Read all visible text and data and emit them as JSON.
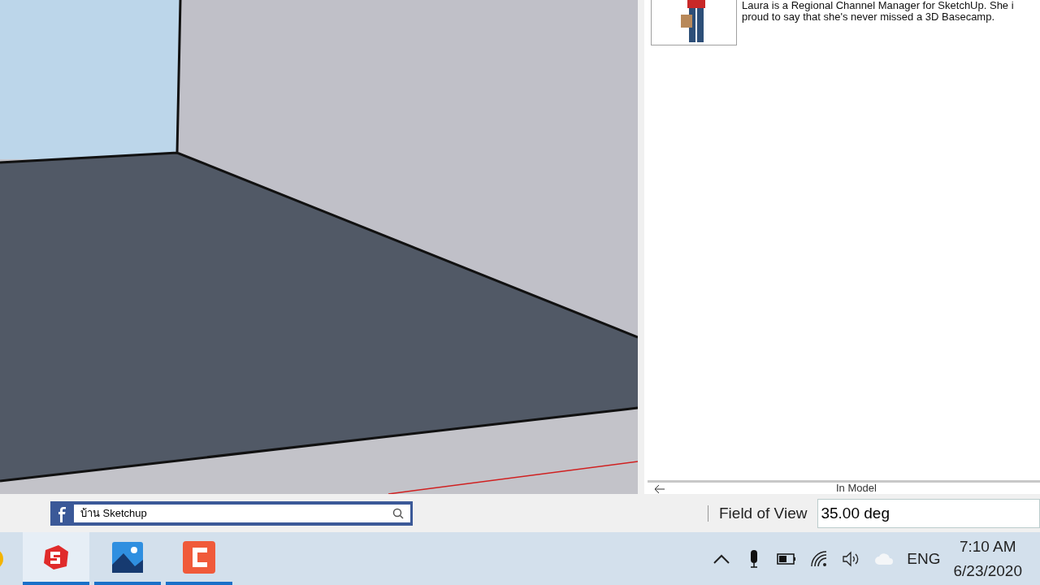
{
  "profile": {
    "bio_lines": [
      "Laura is a Regional Channel Manager for SketchUp. She i",
      "proud to say that she's never missed a 3D Basecamp."
    ]
  },
  "panel_footer": {
    "label": "In Model"
  },
  "search_bar": {
    "value": "บ้าน Sketchup"
  },
  "measurements": {
    "label": "Field of View",
    "value": "35.00 deg"
  },
  "taskbar": {
    "apps": [
      {
        "kind": "sketchup",
        "selected": true
      },
      {
        "kind": "photos",
        "selected": false
      },
      {
        "kind": "recorder",
        "selected": false
      }
    ],
    "tray": {
      "language": "ENG",
      "time": "7:10 AM",
      "date": "6/23/2020"
    }
  }
}
